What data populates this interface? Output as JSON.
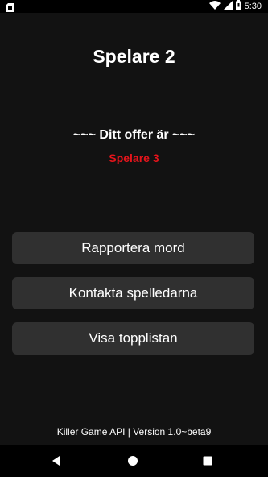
{
  "status_bar": {
    "time": "5:30",
    "icons": [
      "sim-card-icon",
      "wifi-icon",
      "signal-icon",
      "battery-icon"
    ]
  },
  "screen": {
    "player_name": "Spelare 2",
    "victim_heading": "~~~ Ditt offer är ~~~",
    "victim_name": "Spelare 3",
    "victim_color": "#e5141b",
    "buttons": {
      "report_murder": "Rapportera mord",
      "contact_leaders": "Kontakta spelledarna",
      "show_toplist": "Visa topplistan"
    },
    "footer": "Killer Game API | Version 1.0~beta9"
  },
  "nav_bar": {
    "icons": [
      "back-icon",
      "home-icon",
      "recent-apps-icon"
    ]
  },
  "colors": {
    "background": "#121212",
    "button": "#303030",
    "text": "#ffffff",
    "accent": "#e5141b"
  }
}
